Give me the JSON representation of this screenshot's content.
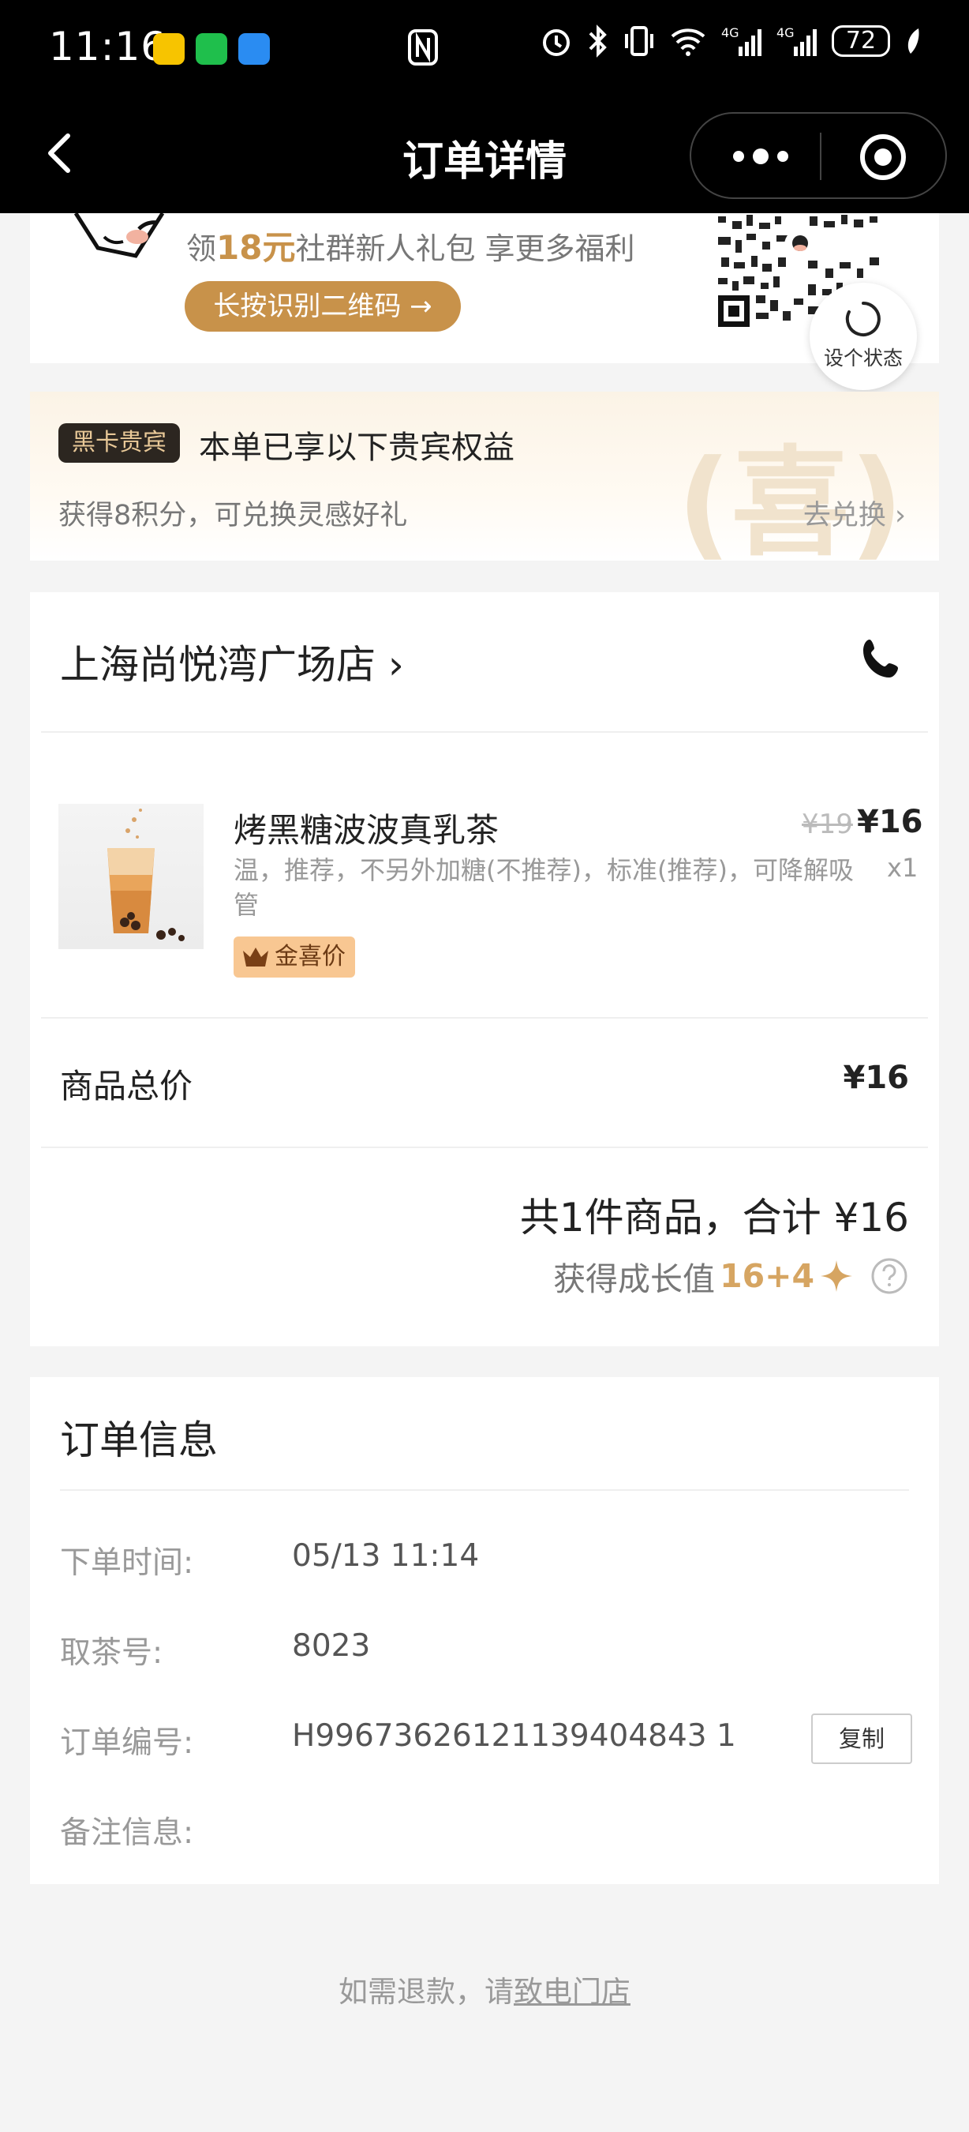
{
  "status_bar": {
    "time": "11:16",
    "battery": "72"
  },
  "nav": {
    "title": "订单详情"
  },
  "promo": {
    "prefix": "领",
    "amount": "18元",
    "suffix": "社群新人礼包 享更多福利",
    "button": "长按识别二维码 →",
    "status_button": "设个状态"
  },
  "vip": {
    "badge": "黑卡贵宾",
    "title": "本单已享以下贵宾权益",
    "subtitle": "获得8积分，可兑换灵感好礼",
    "link": "去兑换 ›",
    "watermark": "喜"
  },
  "order": {
    "store": "上海尚悦湾广场店 ›",
    "product": {
      "name": "烤黑糖波波真乳茶",
      "old_price": "¥19",
      "price": "¥16",
      "spec": "温，推荐，不另外加糖(不推荐)，标准(推荐)，可降解吸管",
      "qty": "x1",
      "tag": "金喜价"
    },
    "subtotal_label": "商品总价",
    "subtotal_value": "¥16",
    "total": "共1件商品，合计 ¥16",
    "growth_label": "获得成长值",
    "growth_value": "16+4"
  },
  "info": {
    "title": "订单信息",
    "rows": [
      {
        "label": "下单时间:",
        "value": "05/13 11:14"
      },
      {
        "label": "取茶号:",
        "value": "8023"
      },
      {
        "label": "订单编号:",
        "value": "H99673626121139404843 1"
      },
      {
        "label": "备注信息:",
        "value": ""
      }
    ],
    "copy": "复制"
  },
  "footer": {
    "refund_prefix": "如需退款，请",
    "refund_link": "致电门店"
  }
}
